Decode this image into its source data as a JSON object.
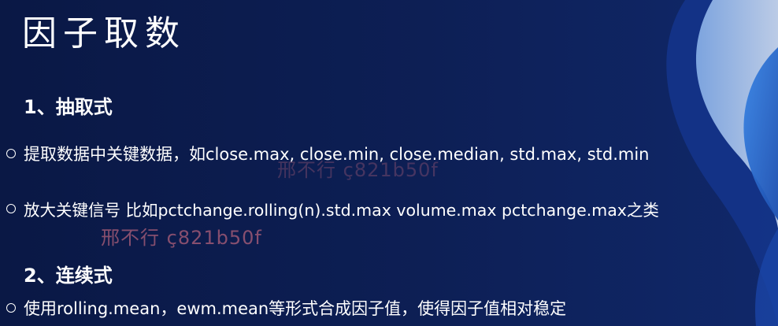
{
  "slide": {
    "title": "因子取数",
    "sections": [
      {
        "heading": "1、抽取式"
      },
      {
        "heading": "2、连续式"
      }
    ],
    "bullets": [
      "提取数据中关键数据，如close.max, close.min, close.median, std.max, std.min",
      "放大关键信号 比如pctchange.rolling(n).std.max  volume.max pctchange.max之类",
      "使用rolling.mean，ewm.mean等形式合成因子值，使得因子值相对稳定"
    ],
    "watermarks": [
      "邢不行 ç821b50f",
      "邢不行 ç821b50f"
    ]
  },
  "colors": {
    "background": "#0c1c4e",
    "text": "#ffffff",
    "accent_blue": "#2f73d8",
    "watermark": "#b0607a"
  }
}
